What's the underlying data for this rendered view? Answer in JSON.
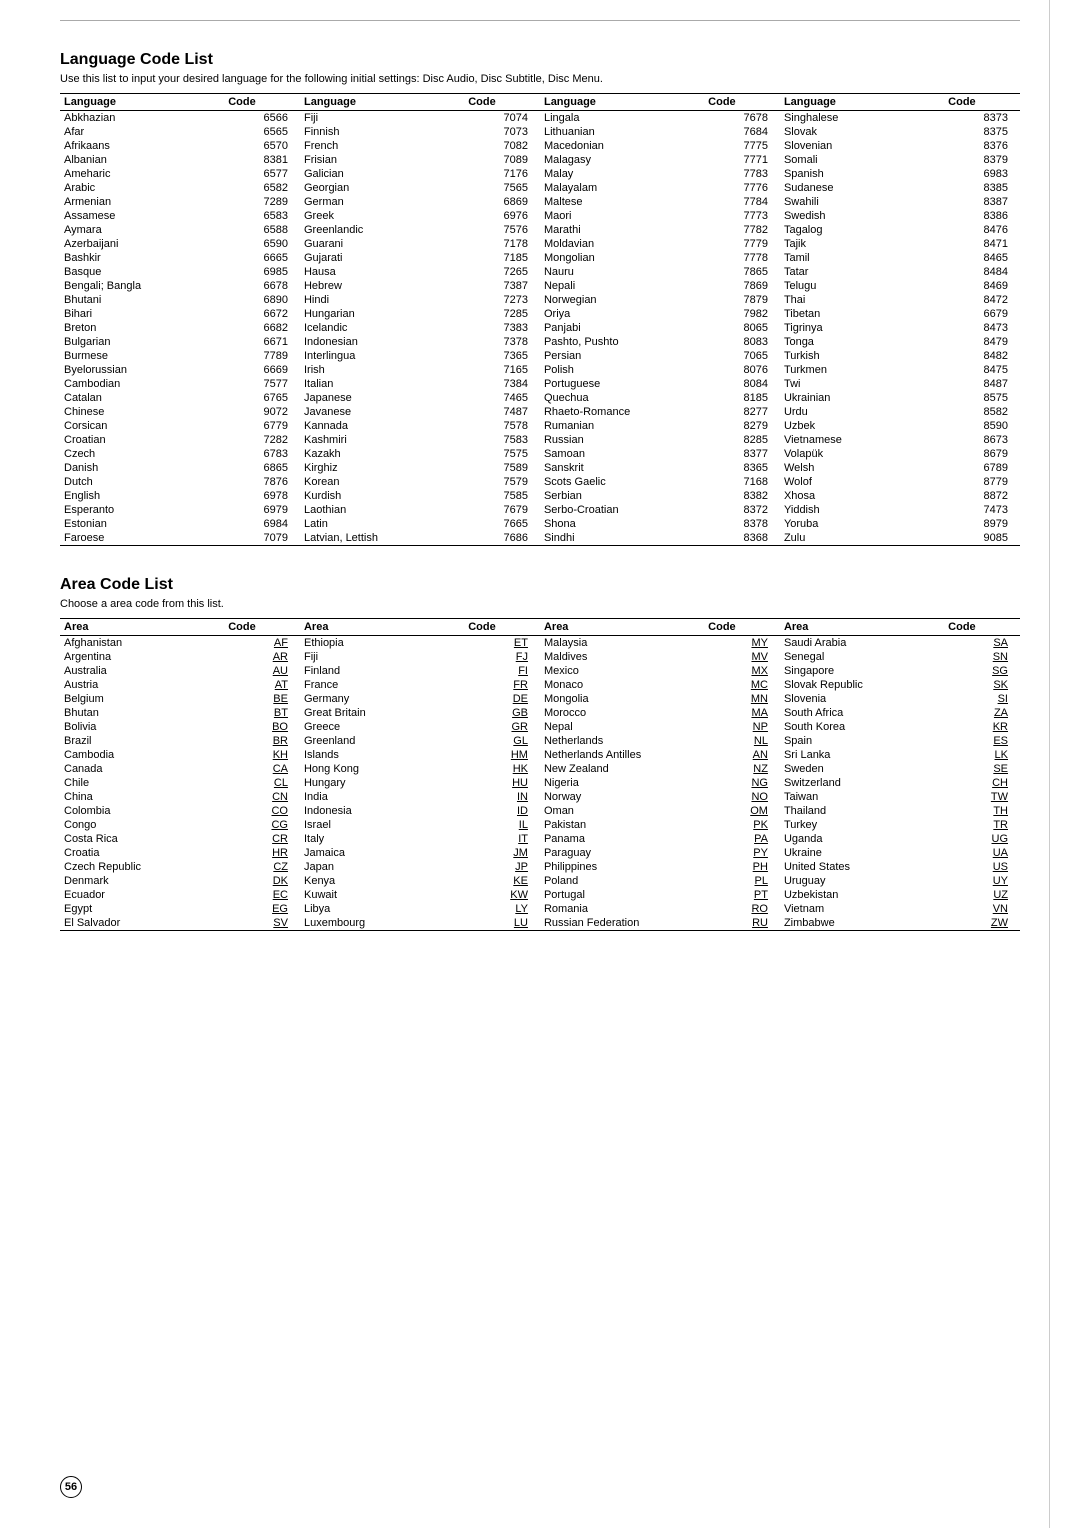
{
  "page": {
    "number": "56",
    "top_rule": true
  },
  "language_section": {
    "title": "Language Code List",
    "description": "Use this list to input your desired language for the following initial settings: Disc Audio, Disc Subtitle, Disc Menu.",
    "columns": [
      "Language",
      "Code",
      "Language",
      "Code",
      "Language",
      "Code",
      "Language",
      "Code"
    ],
    "rows": [
      [
        "Abkhazian",
        "6566",
        "Fiji",
        "7074",
        "Lingala",
        "7678",
        "Singhalese",
        "8373"
      ],
      [
        "Afar",
        "6565",
        "Finnish",
        "7073",
        "Lithuanian",
        "7684",
        "Slovak",
        "8375"
      ],
      [
        "Afrikaans",
        "6570",
        "French",
        "7082",
        "Macedonian",
        "7775",
        "Slovenian",
        "8376"
      ],
      [
        "Albanian",
        "8381",
        "Frisian",
        "7089",
        "Malagasy",
        "7771",
        "Somali",
        "8379"
      ],
      [
        "Ameharic",
        "6577",
        "Galician",
        "7176",
        "Malay",
        "7783",
        "Spanish",
        "6983"
      ],
      [
        "Arabic",
        "6582",
        "Georgian",
        "7565",
        "Malayalam",
        "7776",
        "Sudanese",
        "8385"
      ],
      [
        "Armenian",
        "7289",
        "German",
        "6869",
        "Maltese",
        "7784",
        "Swahili",
        "8387"
      ],
      [
        "Assamese",
        "6583",
        "Greek",
        "6976",
        "Maori",
        "7773",
        "Swedish",
        "8386"
      ],
      [
        "Aymara",
        "6588",
        "Greenlandic",
        "7576",
        "Marathi",
        "7782",
        "Tagalog",
        "8476"
      ],
      [
        "Azerbaijani",
        "6590",
        "Guarani",
        "7178",
        "Moldavian",
        "7779",
        "Tajik",
        "8471"
      ],
      [
        "Bashkir",
        "6665",
        "Gujarati",
        "7185",
        "Mongolian",
        "7778",
        "Tamil",
        "8465"
      ],
      [
        "Basque",
        "6985",
        "Hausa",
        "7265",
        "Nauru",
        "7865",
        "Tatar",
        "8484"
      ],
      [
        "Bengali; Bangla",
        "6678",
        "Hebrew",
        "7387",
        "Nepali",
        "7869",
        "Telugu",
        "8469"
      ],
      [
        "Bhutani",
        "6890",
        "Hindi",
        "7273",
        "Norwegian",
        "7879",
        "Thai",
        "8472"
      ],
      [
        "Bihari",
        "6672",
        "Hungarian",
        "7285",
        "Oriya",
        "7982",
        "Tibetan",
        "6679"
      ],
      [
        "Breton",
        "6682",
        "Icelandic",
        "7383",
        "Panjabi",
        "8065",
        "Tigrinya",
        "8473"
      ],
      [
        "Bulgarian",
        "6671",
        "Indonesian",
        "7378",
        "Pashto, Pushto",
        "8083",
        "Tonga",
        "8479"
      ],
      [
        "Burmese",
        "7789",
        "Interlingua",
        "7365",
        "Persian",
        "7065",
        "Turkish",
        "8482"
      ],
      [
        "Byelorussian",
        "6669",
        "Irish",
        "7165",
        "Polish",
        "8076",
        "Turkmen",
        "8475"
      ],
      [
        "Cambodian",
        "7577",
        "Italian",
        "7384",
        "Portuguese",
        "8084",
        "Twi",
        "8487"
      ],
      [
        "Catalan",
        "6765",
        "Japanese",
        "7465",
        "Quechua",
        "8185",
        "Ukrainian",
        "8575"
      ],
      [
        "Chinese",
        "9072",
        "Javanese",
        "7487",
        "Rhaeto-Romance",
        "8277",
        "Urdu",
        "8582"
      ],
      [
        "Corsican",
        "6779",
        "Kannada",
        "7578",
        "Rumanian",
        "8279",
        "Uzbek",
        "8590"
      ],
      [
        "Croatian",
        "7282",
        "Kashmiri",
        "7583",
        "Russian",
        "8285",
        "Vietnamese",
        "8673"
      ],
      [
        "Czech",
        "6783",
        "Kazakh",
        "7575",
        "Samoan",
        "8377",
        "Volapük",
        "8679"
      ],
      [
        "Danish",
        "6865",
        "Kirghiz",
        "7589",
        "Sanskrit",
        "8365",
        "Welsh",
        "6789"
      ],
      [
        "Dutch",
        "7876",
        "Korean",
        "7579",
        "Scots Gaelic",
        "7168",
        "Wolof",
        "8779"
      ],
      [
        "English",
        "6978",
        "Kurdish",
        "7585",
        "Serbian",
        "8382",
        "Xhosa",
        "8872"
      ],
      [
        "Esperanto",
        "6979",
        "Laothian",
        "7679",
        "Serbo-Croatian",
        "8372",
        "Yiddish",
        "7473"
      ],
      [
        "Estonian",
        "6984",
        "Latin",
        "7665",
        "Shona",
        "8378",
        "Yoruba",
        "8979"
      ],
      [
        "Faroese",
        "7079",
        "Latvian, Lettish",
        "7686",
        "Sindhi",
        "8368",
        "Zulu",
        "9085"
      ]
    ]
  },
  "area_section": {
    "title": "Area Code List",
    "description": "Choose a area code from this list.",
    "columns": [
      "Area",
      "Code",
      "Area",
      "Code",
      "Area",
      "Code",
      "Area",
      "Code"
    ],
    "rows": [
      [
        "Afghanistan",
        "AF",
        "Ethiopia",
        "ET",
        "Malaysia",
        "MY",
        "Saudi Arabia",
        "SA"
      ],
      [
        "Argentina",
        "AR",
        "Fiji",
        "FJ",
        "Maldives",
        "MV",
        "Senegal",
        "SN"
      ],
      [
        "Australia",
        "AU",
        "Finland",
        "FI",
        "Mexico",
        "MX",
        "Singapore",
        "SG"
      ],
      [
        "Austria",
        "AT",
        "France",
        "FR",
        "Monaco",
        "MC",
        "Slovak Republic",
        "SK"
      ],
      [
        "Belgium",
        "BE",
        "Germany",
        "DE",
        "Mongolia",
        "MN",
        "Slovenia",
        "SI"
      ],
      [
        "Bhutan",
        "BT",
        "Great Britain",
        "GB",
        "Morocco",
        "MA",
        "South Africa",
        "ZA"
      ],
      [
        "Bolivia",
        "BO",
        "Greece",
        "GR",
        "Nepal",
        "NP",
        "South Korea",
        "KR"
      ],
      [
        "Brazil",
        "BR",
        "Greenland",
        "GL",
        "Netherlands",
        "NL",
        "Spain",
        "ES"
      ],
      [
        "Cambodia",
        "KH",
        "Islands",
        "HM",
        "Netherlands Antilles",
        "AN",
        "Sri Lanka",
        "LK"
      ],
      [
        "Canada",
        "CA",
        "Hong Kong",
        "HK",
        "New Zealand",
        "NZ",
        "Sweden",
        "SE"
      ],
      [
        "Chile",
        "CL",
        "Hungary",
        "HU",
        "Nigeria",
        "NG",
        "Switzerland",
        "CH"
      ],
      [
        "China",
        "CN",
        "India",
        "IN",
        "Norway",
        "NO",
        "Taiwan",
        "TW"
      ],
      [
        "Colombia",
        "CO",
        "Indonesia",
        "ID",
        "Oman",
        "OM",
        "Thailand",
        "TH"
      ],
      [
        "Congo",
        "CG",
        "Israel",
        "IL",
        "Pakistan",
        "PK",
        "Turkey",
        "TR"
      ],
      [
        "Costa Rica",
        "CR",
        "Italy",
        "IT",
        "Panama",
        "PA",
        "Uganda",
        "UG"
      ],
      [
        "Croatia",
        "HR",
        "Jamaica",
        "JM",
        "Paraguay",
        "PY",
        "Ukraine",
        "UA"
      ],
      [
        "Czech Republic",
        "CZ",
        "Japan",
        "JP",
        "Philippines",
        "PH",
        "United States",
        "US"
      ],
      [
        "Denmark",
        "DK",
        "Kenya",
        "KE",
        "Poland",
        "PL",
        "Uruguay",
        "UY"
      ],
      [
        "Ecuador",
        "EC",
        "Kuwait",
        "KW",
        "Portugal",
        "PT",
        "Uzbekistan",
        "UZ"
      ],
      [
        "Egypt",
        "EG",
        "Libya",
        "LY",
        "Romania",
        "RO",
        "Vietnam",
        "VN"
      ],
      [
        "El Salvador",
        "SV",
        "Luxembourg",
        "LU",
        "Russian Federation",
        "RU",
        "Zimbabwe",
        "ZW"
      ]
    ]
  }
}
